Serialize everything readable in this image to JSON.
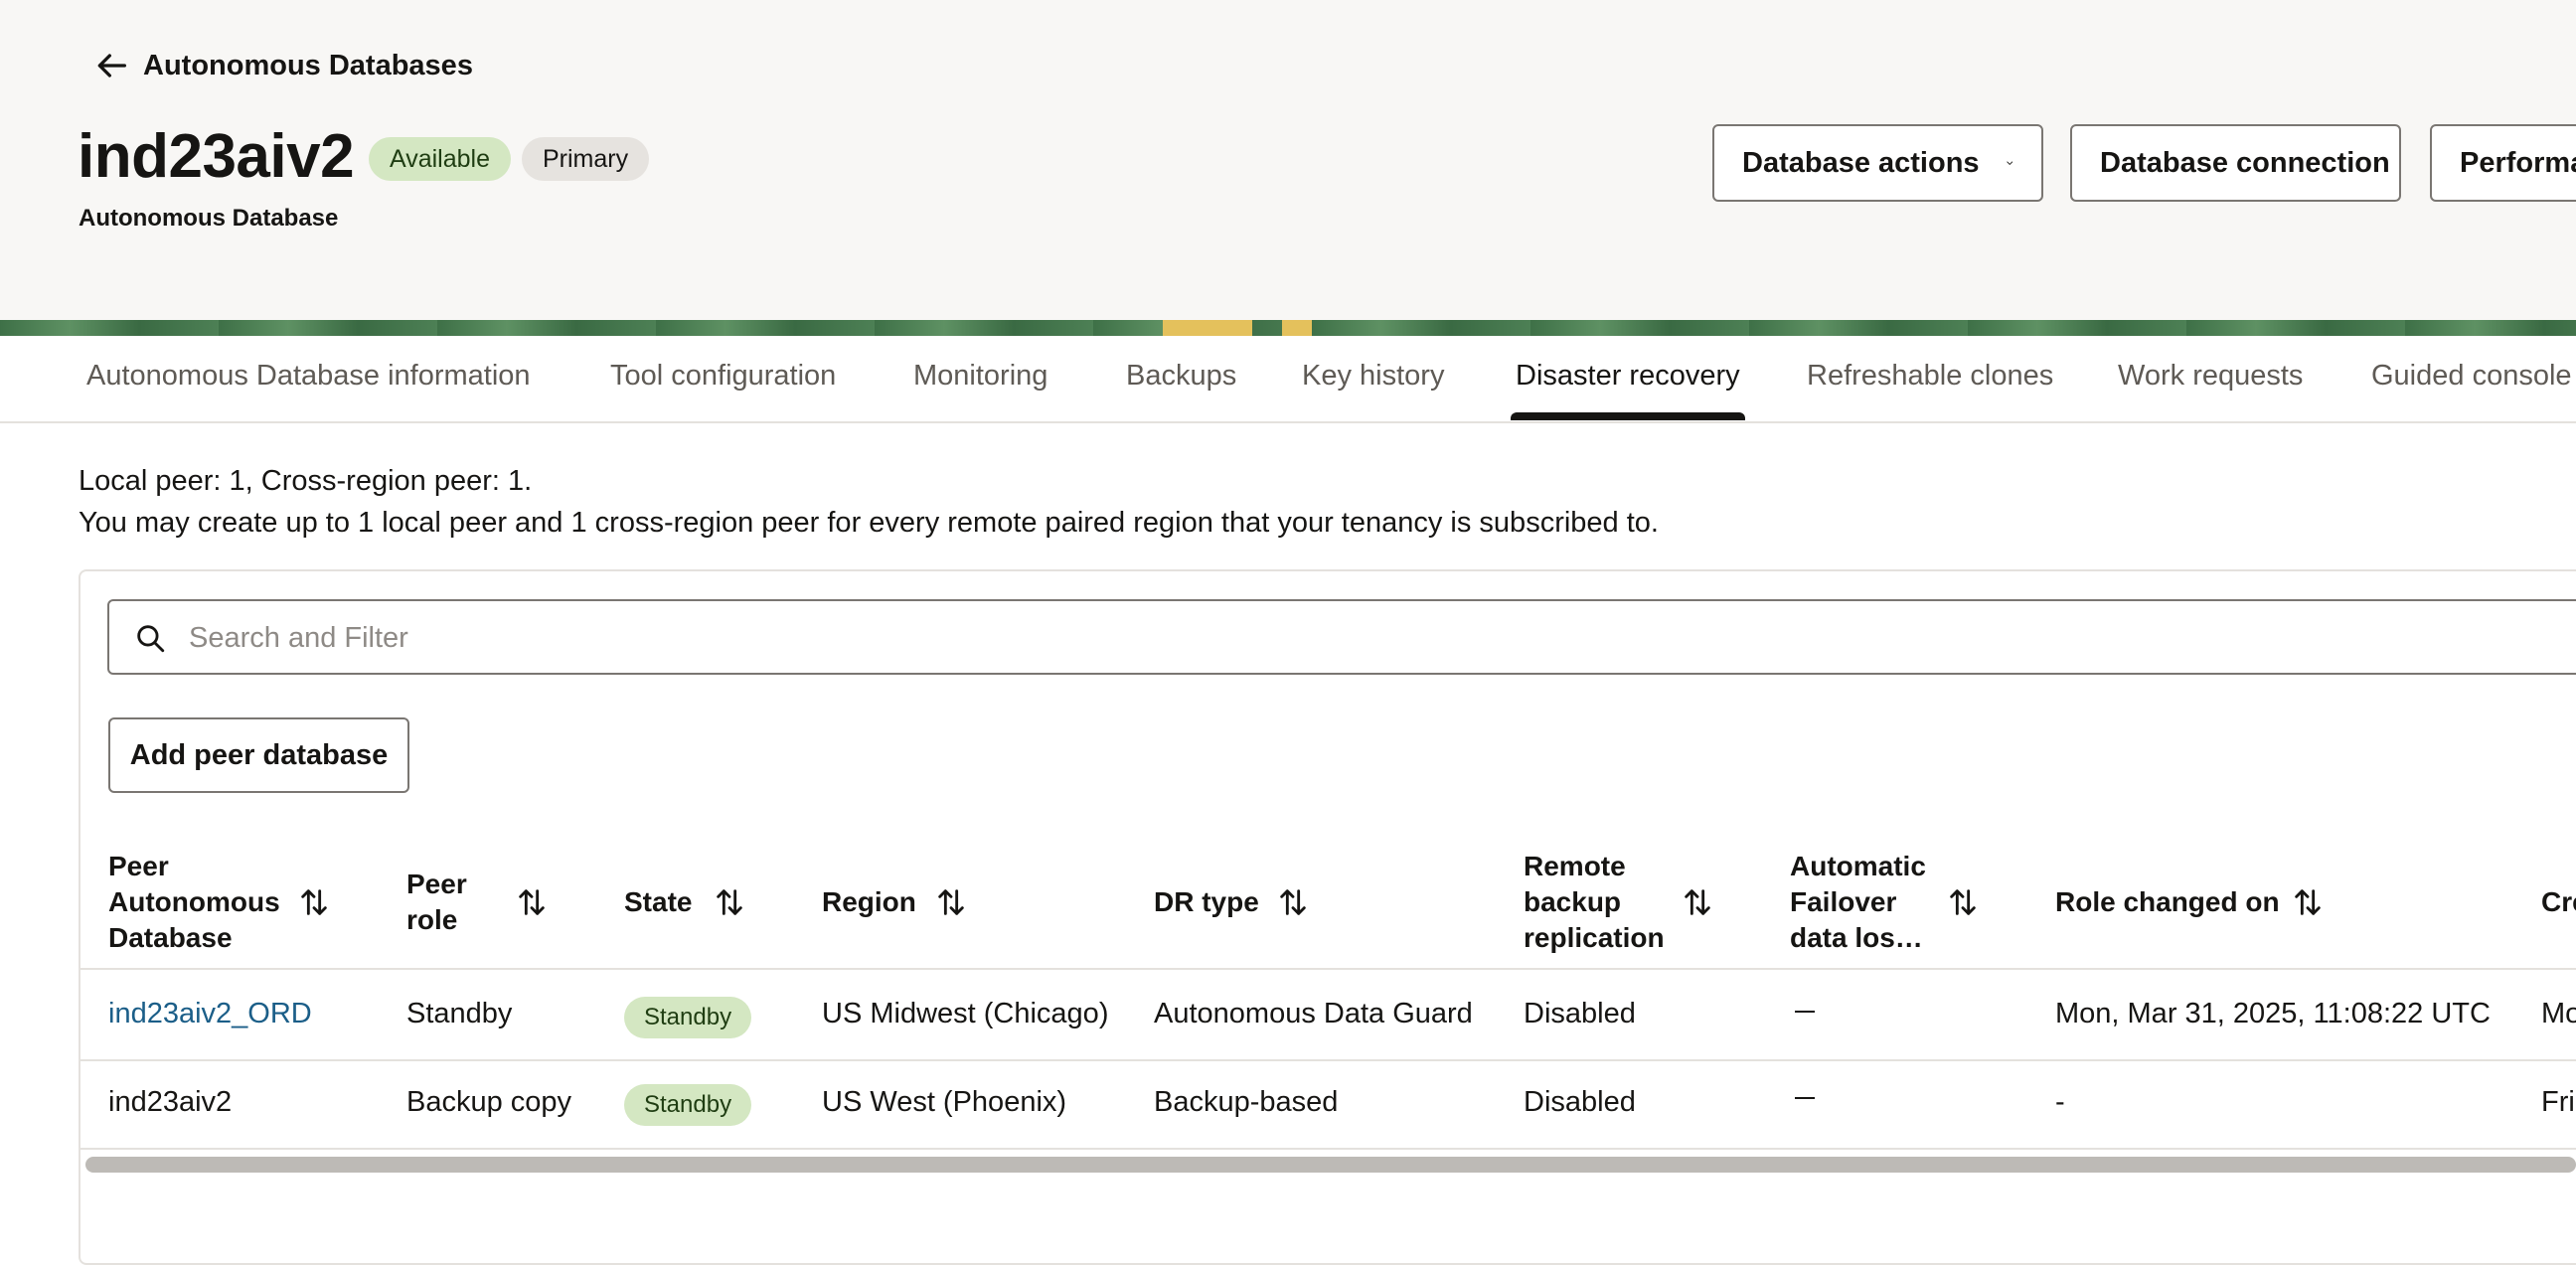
{
  "header": {
    "back_label": "Autonomous Databases",
    "title": "ind23aiv2",
    "subtitle": "Autonomous Database",
    "badges": {
      "status": "Available",
      "role": "Primary"
    },
    "buttons": {
      "actions": "Database actions",
      "connection": "Database connection",
      "performance": "Performance Hub"
    }
  },
  "tabs": [
    {
      "label": "Autonomous Database information"
    },
    {
      "label": "Tool configuration"
    },
    {
      "label": "Monitoring"
    },
    {
      "label": "Backups"
    },
    {
      "label": "Key history"
    },
    {
      "label": "Disaster recovery"
    },
    {
      "label": "Refreshable clones"
    },
    {
      "label": "Work requests"
    },
    {
      "label": "Guided console"
    }
  ],
  "active_tab": "Disaster recovery",
  "info": {
    "line1": "Local peer: 1, Cross-region peer: 1.",
    "line2": "You may create up to 1 local peer and 1 cross-region peer for every remote paired region that your tenancy is subscribed to."
  },
  "search": {
    "placeholder": "Search and Filter"
  },
  "add_button": "Add peer database",
  "table": {
    "columns": [
      {
        "label": "Peer Autonomous Database",
        "lines": [
          "Peer",
          "Autonomous",
          "Database"
        ]
      },
      {
        "label": "Peer role",
        "lines": [
          "Peer",
          "role"
        ]
      },
      {
        "label": "State",
        "lines": [
          "State"
        ]
      },
      {
        "label": "Region",
        "lines": [
          "Region"
        ]
      },
      {
        "label": "DR type",
        "lines": [
          "DR type"
        ]
      },
      {
        "label": "Remote backup replication",
        "lines": [
          "Remote",
          "backup",
          "replication"
        ]
      },
      {
        "label": "Automatic Failover data los...",
        "lines": [
          "Automatic",
          "Failover",
          "data los…"
        ]
      },
      {
        "label": "Role changed on",
        "lines": [
          "Role changed on"
        ]
      },
      {
        "label": "Created",
        "lines": [
          "Created"
        ]
      }
    ],
    "rows": [
      {
        "name": "ind23aiv2_ORD",
        "peer_role": "Standby",
        "state": "Standby",
        "region": "US Midwest (Chicago)",
        "dr_type": "Autonomous Data Guard",
        "remote_backup": "Disabled",
        "role_changed_on": "Mon, Mar 31, 2025, 11:08:22 UTC",
        "created": "Mon"
      },
      {
        "name": "ind23aiv2",
        "peer_role": "Backup copy",
        "state": "Standby",
        "region": "US West (Phoenix)",
        "dr_type": "Backup-based",
        "remote_backup": "Disabled",
        "role_changed_on": "-",
        "created": "Fri"
      }
    ]
  },
  "colors": {
    "header_bg": "#f8f7f5",
    "badge_available": "#d4e7c2",
    "badge_primary": "#e6e3df",
    "link": "#1b5e88",
    "banner_green": "#4d8055",
    "banner_yellow": "#e4c15c"
  },
  "icons": {
    "back": "arrow-left-icon",
    "dropdown": "chevron-down-icon",
    "search": "search-icon",
    "sort": "sort-arrows-icon"
  }
}
